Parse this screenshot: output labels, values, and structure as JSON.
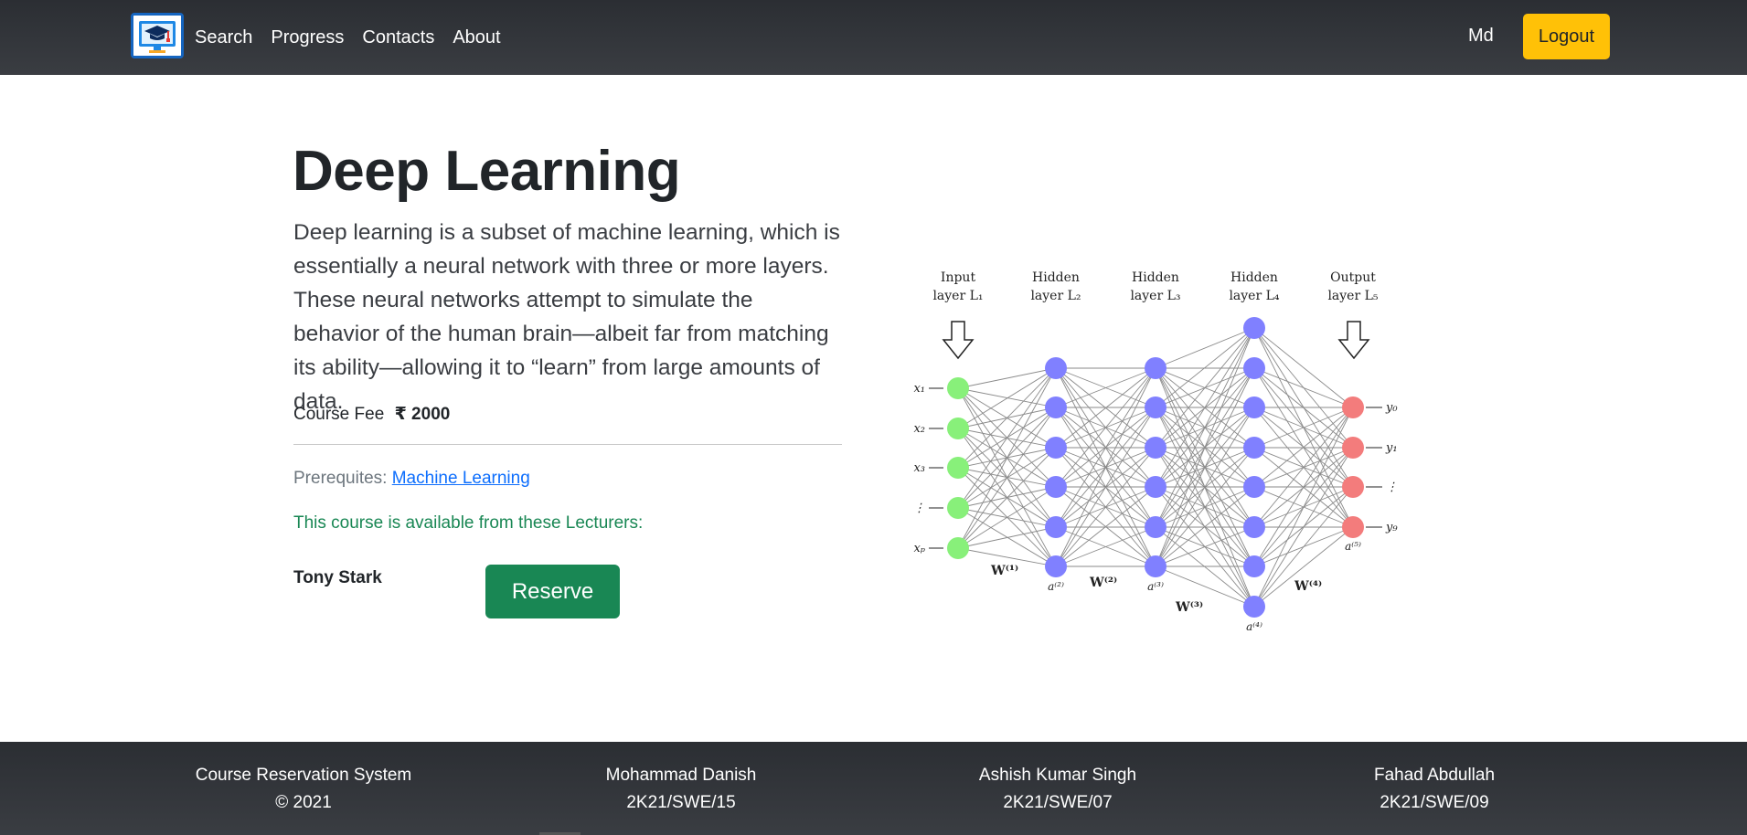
{
  "nav": {
    "links": [
      "Search",
      "Progress",
      "Contacts",
      "About"
    ],
    "user": "Md",
    "logout_label": "Logout"
  },
  "course": {
    "title": "Deep Learning",
    "description": "Deep learning is a subset of machine learning, which is essentially a neural network with three or more layers. These neural networks attempt to simulate the behavior of the human brain—albeit far from matching its ability—allowing it to “learn” from large amounts of data.",
    "fee_label": "Course Fee",
    "fee_value": "₹ 2000",
    "prereq_label": "Prerequites:",
    "prereq_link": "Machine Learning",
    "lecturers_note": "This course is available from these Lecturers:",
    "lecturer": "Tony Stark",
    "reserve_label": "Reserve"
  },
  "diagram": {
    "layer_headers": [
      {
        "line1": "Input",
        "line2": "layer L₁"
      },
      {
        "line1": "Hidden",
        "line2": "layer L₂"
      },
      {
        "line1": "Hidden",
        "line2": "layer L₃"
      },
      {
        "line1": "Hidden",
        "line2": "layer L₄"
      },
      {
        "line1": "Output",
        "line2": "layer L₅"
      }
    ],
    "inputs": [
      "x₁",
      "x₂",
      "x₃",
      "⋮",
      "xₚ"
    ],
    "outputs": [
      "y₀",
      "y₁",
      "⋮",
      "y₉"
    ],
    "activations": [
      "a⁽²⁾",
      "a⁽³⁾",
      "a⁽⁴⁾",
      "a⁽⁵⁾"
    ],
    "weights": [
      "W⁽¹⁾",
      "W⁽²⁾",
      "W⁽³⁾",
      "W⁽⁴⁾"
    ],
    "colors": {
      "input": "#88f07a",
      "hidden": "#8080ff",
      "output": "#f37c7c",
      "edge": "#8a8a8a"
    }
  },
  "footer": {
    "columns": [
      {
        "line1": "Course Reservation System",
        "line2": "© 2021"
      },
      {
        "line1": "Mohammad Danish",
        "line2": "2K21/SWE/15"
      },
      {
        "line1": "Ashish Kumar Singh",
        "line2": "2K21/SWE/07"
      },
      {
        "line1": "Fahad Abdullah",
        "line2": "2K21/SWE/09"
      }
    ]
  }
}
